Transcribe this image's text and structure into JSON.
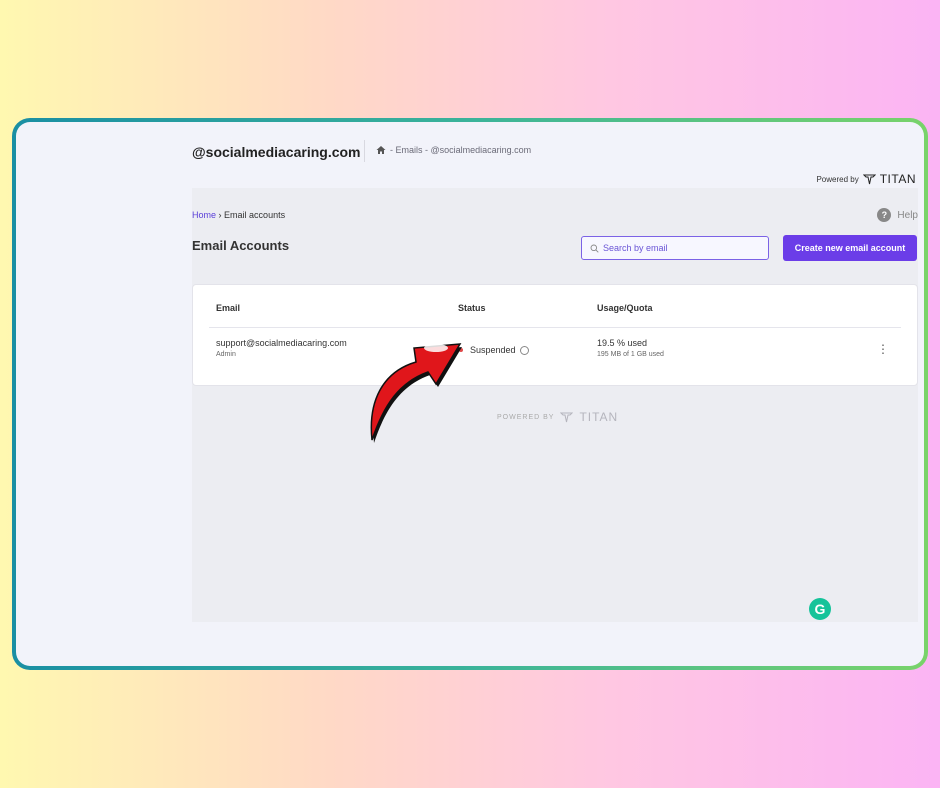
{
  "header": {
    "domain": "@socialmediacaring.com",
    "breadcrumb_top": "- Emails - @socialmediacaring.com",
    "powered_by": "Powered by",
    "brand": "TITAN"
  },
  "breadcrumb": {
    "home": "Home",
    "separator": "›",
    "current": "Email accounts"
  },
  "help_label": "Help",
  "page_title": "Email Accounts",
  "search": {
    "placeholder": "Search by email",
    "value": ""
  },
  "create_button": "Create new email account",
  "table": {
    "headers": {
      "email": "Email",
      "status": "Status",
      "usage": "Usage/Quota"
    },
    "rows": [
      {
        "email": "support@socialmediacaring.com",
        "role": "Admin",
        "status": "Suspended",
        "usage_percent": "19.5 % used",
        "usage_detail": "195 MB of 1 GB used"
      }
    ]
  },
  "footer": {
    "powered_by": "POWERED BY",
    "brand": "TITAN"
  },
  "icons": {
    "home": "home-icon",
    "search": "search-icon",
    "help": "help-icon",
    "info": "info-icon",
    "more": "kebab-menu-icon",
    "grammarly": "grammarly-icon",
    "arrow": "red-arrow-icon"
  },
  "colors": {
    "accent": "#6b3de8",
    "status_suspended": "#e04a4a",
    "frame_start": "#1a8fa3",
    "frame_end": "#79d36a"
  }
}
